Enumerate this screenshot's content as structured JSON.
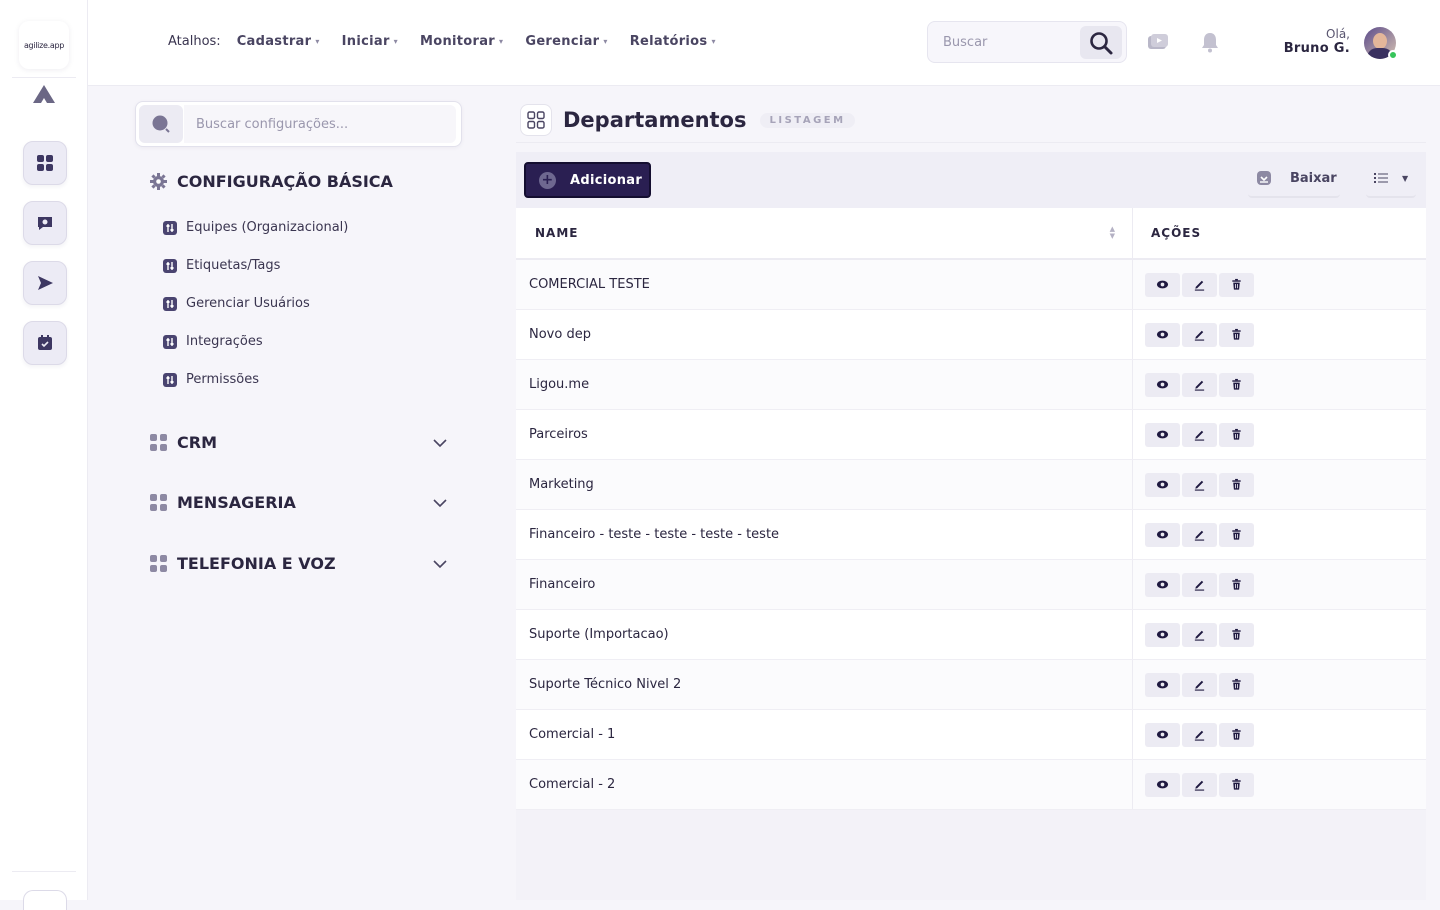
{
  "brand": {
    "logo_text": "agilize.app"
  },
  "header": {
    "shortcuts_label": "Atalhos:",
    "nav": [
      {
        "label": "Cadastrar"
      },
      {
        "label": "Iniciar"
      },
      {
        "label": "Monitorar"
      },
      {
        "label": "Gerenciar"
      },
      {
        "label": "Relatórios"
      }
    ],
    "search_placeholder": "Buscar",
    "greeting": "Olá,",
    "user_name": "Bruno G."
  },
  "settings": {
    "search_placeholder": "Buscar configurações...",
    "sections": [
      {
        "title": "CONFIGURAÇÃO BÁSICA",
        "items": [
          {
            "label": "Equipes (Organizacional)"
          },
          {
            "label": "Etiquetas/Tags"
          },
          {
            "label": "Gerenciar Usuários"
          },
          {
            "label": "Integrações"
          },
          {
            "label": "Permissões"
          }
        ]
      },
      {
        "title": "CRM"
      },
      {
        "title": "MENSAGERIA"
      },
      {
        "title": "TELEFONIA E VOZ"
      }
    ]
  },
  "main": {
    "title": "Departamentos",
    "badge": "LISTAGEM",
    "add_label": "Adicionar",
    "download_label": "Baixar",
    "columns": [
      "NAME",
      "AÇÕES"
    ],
    "rows": [
      "COMERCIAL TESTE",
      "Novo dep",
      "Ligou.me",
      "Parceiros",
      "Marketing",
      "Financeiro - teste - teste - teste - teste",
      "Financeiro",
      "Suporte (Importacao)",
      "Suporte Técnico Nivel 2",
      "Comercial - 1",
      "Comercial - 2"
    ]
  },
  "colors": {
    "primary": "#2a1f52",
    "accent_bg": "#ecebf3",
    "online": "#37c45a"
  }
}
